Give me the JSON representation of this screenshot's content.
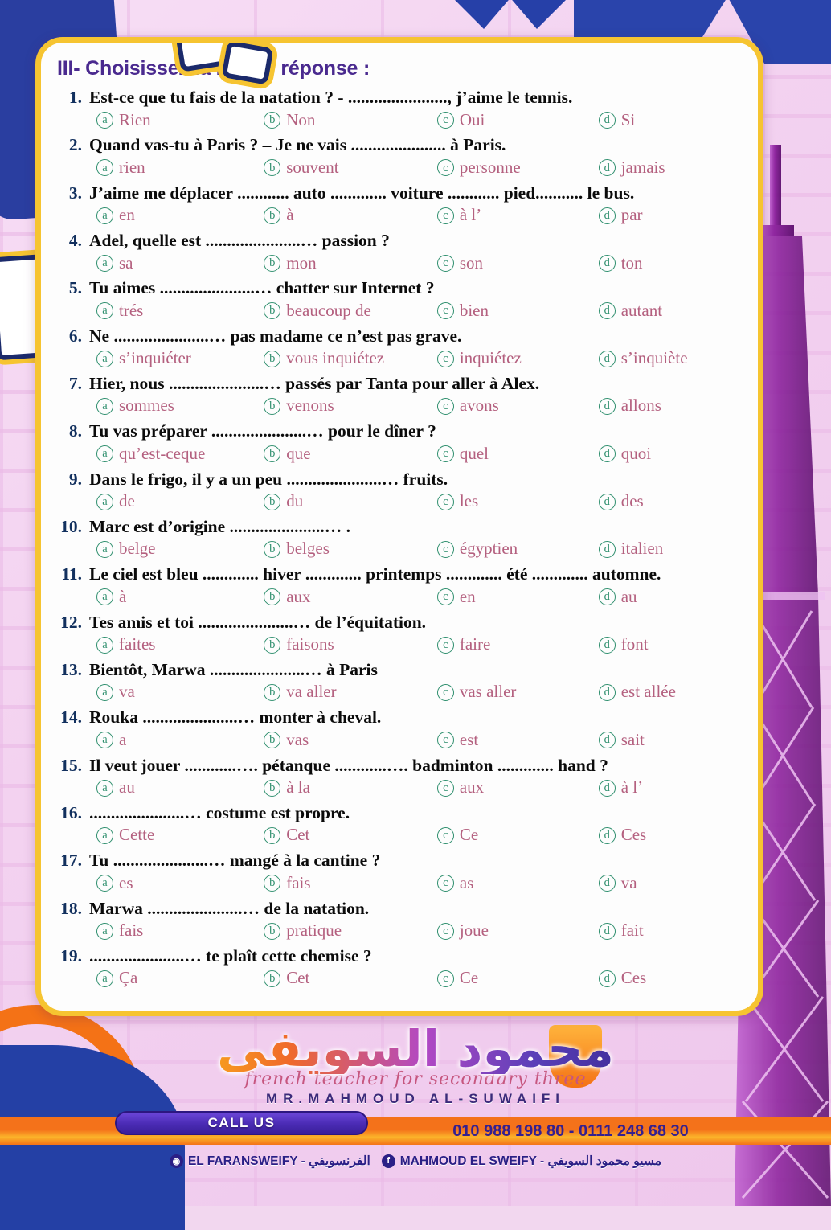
{
  "worksheet": {
    "section_title": "III- Choisissez la bonne réponse :",
    "questions": [
      {
        "num": "1.",
        "text": "Est-ce que tu fais de la natation ? - ......................., j’aime le tennis.",
        "options": [
          {
            "mark": "a",
            "label": "Rien"
          },
          {
            "mark": "b",
            "label": "Non"
          },
          {
            "mark": "c",
            "label": "Oui"
          },
          {
            "mark": "d",
            "label": "Si"
          }
        ]
      },
      {
        "num": "2.",
        "text": "Quand vas-tu à Paris ?     – Je ne vais ...................... à Paris.",
        "options": [
          {
            "mark": "a",
            "label": "rien"
          },
          {
            "mark": "b",
            "label": "souvent"
          },
          {
            "mark": "c",
            "label": "personne"
          },
          {
            "mark": "d",
            "label": "jamais"
          }
        ]
      },
      {
        "num": "3.",
        "text": "J’aime me déplacer ............ auto ............. voiture ............ pied........... le bus.",
        "options": [
          {
            "mark": "a",
            "label": "en"
          },
          {
            "mark": "b",
            "label": "à"
          },
          {
            "mark": "c",
            "label": "à l’"
          },
          {
            "mark": "d",
            "label": "par"
          }
        ]
      },
      {
        "num": "4.",
        "text": "Adel, quelle est ......................… passion ?",
        "options": [
          {
            "mark": "a",
            "label": "sa"
          },
          {
            "mark": "b",
            "label": "mon"
          },
          {
            "mark": "c",
            "label": "son"
          },
          {
            "mark": "d",
            "label": "ton"
          }
        ]
      },
      {
        "num": "5.",
        "text": "Tu aimes ......................… chatter sur Internet ?",
        "options": [
          {
            "mark": "a",
            "label": "trés"
          },
          {
            "mark": "b",
            "label": "beaucoup de"
          },
          {
            "mark": "c",
            "label": "bien"
          },
          {
            "mark": "d",
            "label": "autant"
          }
        ]
      },
      {
        "num": "6.",
        "text": "Ne ......................… pas madame ce n’est pas grave.",
        "options": [
          {
            "mark": "a",
            "label": "s’inquiéter"
          },
          {
            "mark": "b",
            "label": "vous inquiétez"
          },
          {
            "mark": "c",
            "label": "inquiétez"
          },
          {
            "mark": "d",
            "label": "s’inquiète"
          }
        ]
      },
      {
        "num": "7.",
        "text": "Hier, nous ......................… passés par Tanta pour aller à Alex.",
        "options": [
          {
            "mark": "a",
            "label": "sommes"
          },
          {
            "mark": "b",
            "label": "venons"
          },
          {
            "mark": "c",
            "label": "avons"
          },
          {
            "mark": "d",
            "label": "allons"
          }
        ]
      },
      {
        "num": "8.",
        "text": "Tu vas préparer ......................… pour le dîner ?",
        "options": [
          {
            "mark": "a",
            "label": "qu’est-ceque"
          },
          {
            "mark": "b",
            "label": "que"
          },
          {
            "mark": "c",
            "label": "quel"
          },
          {
            "mark": "d",
            "label": "quoi"
          }
        ]
      },
      {
        "num": "9.",
        "text": "Dans le frigo, il y a un peu ......................… fruits.",
        "options": [
          {
            "mark": "a",
            "label": "de"
          },
          {
            "mark": "b",
            "label": "du"
          },
          {
            "mark": "c",
            "label": "les"
          },
          {
            "mark": "d",
            "label": "des"
          }
        ]
      },
      {
        "num": "10.",
        "text": "Marc est d’origine ......................… .",
        "options": [
          {
            "mark": "a",
            "label": "belge"
          },
          {
            "mark": "b",
            "label": "belges"
          },
          {
            "mark": "c",
            "label": "égyptien"
          },
          {
            "mark": "d",
            "label": "italien"
          }
        ]
      },
      {
        "num": "11.",
        "text": "Le ciel est bleu ............. hiver ............. printemps ............. été ............. automne.",
        "options": [
          {
            "mark": "a",
            "label": "à"
          },
          {
            "mark": "b",
            "label": "aux"
          },
          {
            "mark": "c",
            "label": "en"
          },
          {
            "mark": "d",
            "label": "au"
          }
        ]
      },
      {
        "num": "12.",
        "text": "Tes amis et toi ......................… de l’équitation.",
        "options": [
          {
            "mark": "a",
            "label": "faites"
          },
          {
            "mark": "b",
            "label": "faisons"
          },
          {
            "mark": "c",
            "label": "faire"
          },
          {
            "mark": "d",
            "label": "font"
          }
        ]
      },
      {
        "num": "13.",
        "text": "Bientôt, Marwa ......................… à Paris",
        "options": [
          {
            "mark": "a",
            "label": "va"
          },
          {
            "mark": "b",
            "label": "va aller"
          },
          {
            "mark": "c",
            "label": "vas aller"
          },
          {
            "mark": "d",
            "label": "est allée"
          }
        ]
      },
      {
        "num": "14.",
        "text": "Rouka ......................… monter à cheval.",
        "options": [
          {
            "mark": "a",
            "label": "a"
          },
          {
            "mark": "b",
            "label": "vas"
          },
          {
            "mark": "c",
            "label": "est"
          },
          {
            "mark": "d",
            "label": "sait"
          }
        ]
      },
      {
        "num": "15.",
        "text": "Il veut jouer ............…. pétanque ............…. badminton ............. hand ?",
        "options": [
          {
            "mark": "a",
            "label": "au"
          },
          {
            "mark": "b",
            "label": "à la"
          },
          {
            "mark": "c",
            "label": "aux"
          },
          {
            "mark": "d",
            "label": "à l’"
          }
        ]
      },
      {
        "num": "16.",
        "text": "......................… costume est propre.",
        "options": [
          {
            "mark": "a",
            "label": "Cette"
          },
          {
            "mark": "b",
            "label": "Cet"
          },
          {
            "mark": "c",
            "label": "Ce"
          },
          {
            "mark": "d",
            "label": "Ces"
          }
        ]
      },
      {
        "num": "17.",
        "text": "Tu ......................… mangé à la cantine ?",
        "options": [
          {
            "mark": "a",
            "label": "es"
          },
          {
            "mark": "b",
            "label": "fais"
          },
          {
            "mark": "c",
            "label": "as"
          },
          {
            "mark": "d",
            "label": "va"
          }
        ]
      },
      {
        "num": "18.",
        "text": "Marwa ......................… de la natation.",
        "options": [
          {
            "mark": "a",
            "label": "fais"
          },
          {
            "mark": "b",
            "label": "pratique"
          },
          {
            "mark": "c",
            "label": "joue"
          },
          {
            "mark": "d",
            "label": "fait"
          }
        ]
      },
      {
        "num": "19.",
        "text": "......................… te plaît cette chemise ?",
        "options": [
          {
            "mark": "a",
            "label": "Ça"
          },
          {
            "mark": "b",
            "label": "Cet"
          },
          {
            "mark": "c",
            "label": "Ce"
          },
          {
            "mark": "d",
            "label": "Ces"
          }
        ]
      }
    ]
  },
  "footer": {
    "logo_arabic": "محمود السويفي",
    "logo_script": "french teacher for secondary three",
    "logo_name": "MR.MAHMOUD AL-SUWAIFI",
    "call_label": "CALL US",
    "phones": "010 988 198 80 - 0111 248 68 30",
    "social": [
      {
        "icon": "instagram-icon",
        "glyph": "◉",
        "text": "EL FARANSWEIFY - الفرنسويفي"
      },
      {
        "icon": "facebook-icon",
        "glyph": "f",
        "text": "MAHMOUD EL SWEIFY - مسيو محمود السويفي"
      }
    ]
  }
}
